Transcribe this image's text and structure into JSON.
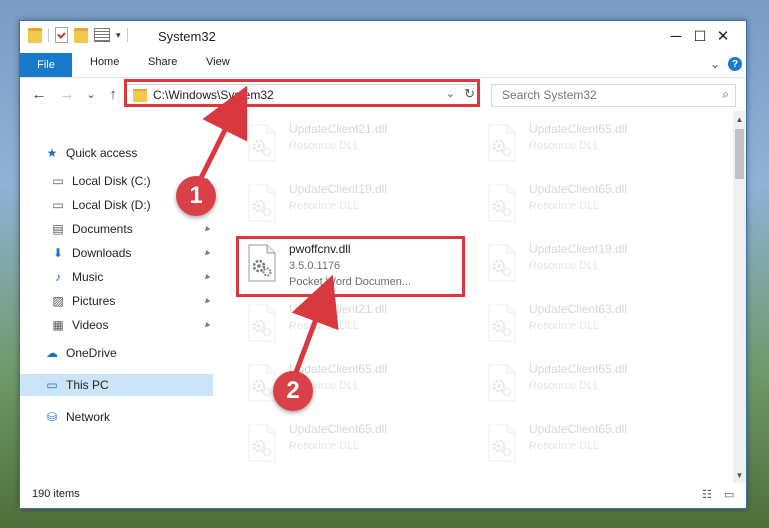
{
  "window": {
    "title": "System32",
    "controls": {
      "minimize": "─",
      "maximize": "☐",
      "close": "✕"
    }
  },
  "ribbon": {
    "tabs": [
      "File",
      "Home",
      "Share",
      "View"
    ],
    "expand": "⌄",
    "help": "?"
  },
  "nav": {
    "back": "←",
    "forward": "→",
    "recent": "⌄",
    "up": "↑",
    "address": "C:\\Windows\\System32",
    "address_dropdown": "⌄",
    "refresh": "↻",
    "search_placeholder": "Search System32"
  },
  "sidebar": {
    "items": [
      {
        "label": "Quick access",
        "icon": "star-icon",
        "glyph": "★",
        "pinned": false
      },
      {
        "label": "Local Disk (C:)",
        "icon": "drive-icon",
        "glyph": "▭",
        "pinned": true
      },
      {
        "label": "Local Disk (D:)",
        "icon": "drive-icon",
        "glyph": "▭",
        "pinned": false
      },
      {
        "label": "Documents",
        "icon": "documents-icon",
        "glyph": "▤",
        "pinned": true
      },
      {
        "label": "Downloads",
        "icon": "downloads-icon",
        "glyph": "⬇",
        "pinned": true
      },
      {
        "label": "Music",
        "icon": "music-icon",
        "glyph": "♪",
        "pinned": true
      },
      {
        "label": "Pictures",
        "icon": "pictures-icon",
        "glyph": "▨",
        "pinned": true
      },
      {
        "label": "Videos",
        "icon": "videos-icon",
        "glyph": "▦",
        "pinned": true
      },
      {
        "label": "OneDrive",
        "icon": "cloud-icon",
        "glyph": "☁",
        "pinned": false
      },
      {
        "label": "This PC",
        "icon": "computer-icon",
        "glyph": "▭",
        "pinned": false,
        "selected": true
      },
      {
        "label": "Network",
        "icon": "network-icon",
        "glyph": "⛁",
        "pinned": false
      }
    ],
    "pin_glyph": "📌"
  },
  "files": {
    "left": [
      {
        "name": "UpdateClient21.dll",
        "type": "Resource DLL"
      },
      {
        "name": "UpdateClient19.dll",
        "type": "Resource DLL"
      },
      {
        "name": "pwoffcnv.dll",
        "version": "3.5.0.1176",
        "type": "Pocket Word Documen...",
        "highlighted": true
      },
      {
        "name": "UpdateClient21.dll",
        "type": "Resource DLL"
      },
      {
        "name": "UpdateClient65.dll",
        "type": "Resource DLL"
      },
      {
        "name": "UpdateClient65.dll",
        "type": "Resource DLL"
      }
    ],
    "right": [
      {
        "name": "UpdateClient65.dll",
        "type": "Resource DLL"
      },
      {
        "name": "UpdateClient65.dll",
        "type": "Resource DLL"
      },
      {
        "name": "UpdateClient19.dll",
        "type": "Resource DLL"
      },
      {
        "name": "UpdateClient63.dll",
        "type": "Resource DLL"
      },
      {
        "name": "UpdateClient65.dll",
        "type": "Resource DLL"
      },
      {
        "name": "UpdateClient65.dll",
        "type": "Resource DLL"
      }
    ]
  },
  "status": {
    "item_count": "190 items"
  },
  "annotations": {
    "marker1": "1",
    "marker2": "2",
    "color": "#d9383f"
  }
}
